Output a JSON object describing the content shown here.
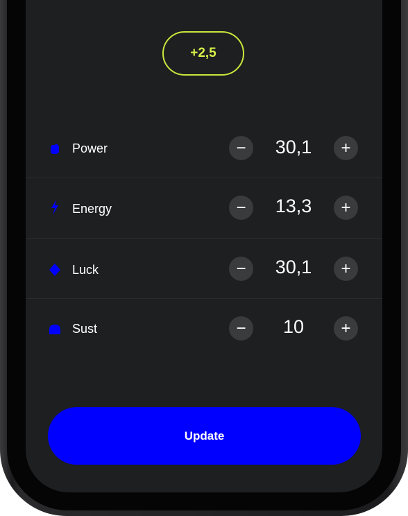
{
  "bonus": {
    "value": "+2,5"
  },
  "stats": [
    {
      "label": "Power",
      "value": "30,1",
      "icon": "fist-icon"
    },
    {
      "label": "Energy",
      "value": "13,3",
      "icon": "lightning-icon"
    },
    {
      "label": "Luck",
      "value": "30,1",
      "icon": "diamond-icon"
    },
    {
      "label": "Sust",
      "value": "10",
      "icon": "shield-icon"
    }
  ],
  "controls": {
    "decrement_label": "−",
    "increment_label": "+"
  },
  "actions": {
    "update_label": "Update"
  },
  "colors": {
    "accent": "#0000FF",
    "bonus": "#D7F047",
    "screen_bg": "#1E1F21"
  }
}
